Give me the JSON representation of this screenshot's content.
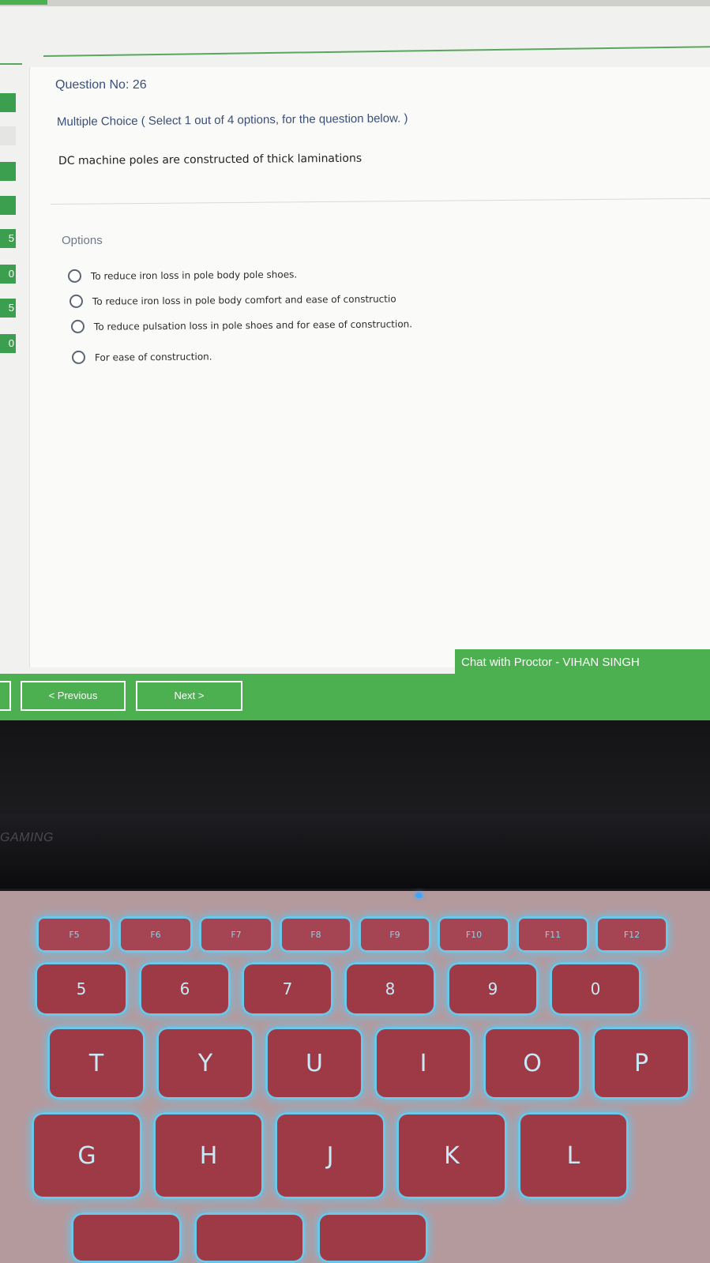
{
  "question": {
    "number_label": "Question No: 26",
    "type_label": "Multiple Choice ( Select 1 out of 4 options, for the question below. )",
    "text": "DC machine poles are constructed of thick laminations"
  },
  "options": {
    "heading": "Options",
    "items": [
      "To reduce iron loss in pole body pole shoes.",
      "To reduce iron loss in pole body comfort and ease of constructio",
      "To reduce pulsation loss in pole shoes and for ease  of construction.",
      "For ease of construction."
    ]
  },
  "left_tabs": [
    "5",
    "0",
    "5",
    "0"
  ],
  "navigation": {
    "previous_label": "< Previous",
    "next_label": "Next >"
  },
  "chat": {
    "label": "Chat with Proctor - VIHAN SINGH"
  },
  "laptop": {
    "brand": "GAMING",
    "fn_keys": [
      "F5",
      "F6",
      "F7",
      "F8",
      "F9",
      "F10",
      "F11",
      "F12"
    ],
    "number_keys": [
      "5",
      "6",
      "7",
      "8",
      "9",
      "0"
    ],
    "letter_row_1": [
      "T",
      "Y",
      "U",
      "I",
      "O",
      "P"
    ],
    "letter_row_2": [
      "G",
      "H",
      "J",
      "K",
      "L"
    ]
  },
  "colors": {
    "accent_green": "#4caf50",
    "text_blue": "#3a4f7a",
    "keyboard_glow": "#5fc7ef"
  }
}
